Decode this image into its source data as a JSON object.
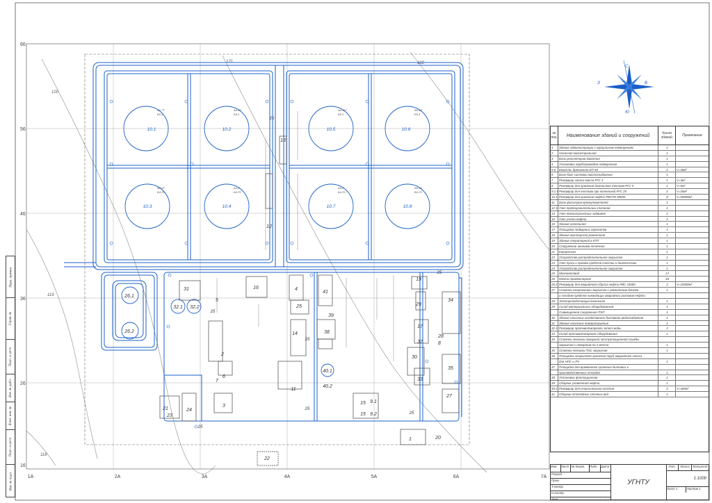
{
  "grid_labels": {
    "rows": [
      "66",
      "56",
      "46",
      "36",
      "26",
      "16"
    ],
    "cols": [
      "1А",
      "2А",
      "3А",
      "4А",
      "5А",
      "6А",
      "7А"
    ]
  },
  "contours": [
    "120",
    "119",
    "118",
    "121",
    "122"
  ],
  "compass": {
    "n": "С",
    "s": "Ю",
    "e": "В",
    "w": "З"
  },
  "tanks": [
    {
      "id": "10.1",
      "tag1": "А2-77",
      "tag2": "Б5-1"
    },
    {
      "id": "10.2",
      "tag1": "А3-97",
      "tag2": "Б5-1"
    },
    {
      "id": "10.5",
      "tag1": "А4-117",
      "tag2": "Б5-1"
    },
    {
      "id": "10.6",
      "tag1": "А5-43",
      "tag2": "Б5-1"
    },
    {
      "id": "10.3",
      "tag1": "А2-97",
      "tag2": "Б4-70"
    },
    {
      "id": "10.4",
      "tag1": "А3-4",
      "tag2": "Б4-70"
    },
    {
      "id": "10.7",
      "tag1": "А4-2",
      "tag2": "Б4-70"
    },
    {
      "id": "10.8",
      "tag1": "А5-54",
      "tag2": "Б4-70"
    }
  ],
  "buildings": [
    "26.1",
    "26.2",
    "31",
    "32.1",
    "32.2",
    "16",
    "25",
    "41",
    "38",
    "40.1",
    "40.2",
    "15",
    "15",
    "9.1",
    "9.2",
    "19",
    "29",
    "17",
    "37",
    "8",
    "28",
    "30",
    "33",
    "27",
    "35",
    "34",
    "5",
    "2",
    "3",
    "4",
    "14",
    "11",
    "21",
    "23",
    "24",
    "6",
    "7",
    "22",
    "1",
    "20",
    "13",
    "12",
    "39"
  ],
  "table": {
    "headers": [
      "№ поз.",
      "Наименование зданий и сооружений",
      "Число зданий",
      "Примечание"
    ],
    "rows": [
      [
        "1",
        "Здание администрации с караульным помещением",
        "1",
        ""
      ],
      [
        "2",
        "Насосная магистральная",
        "1",
        ""
      ],
      [
        "3",
        "Блок регуляторов давления",
        "1",
        ""
      ],
      [
        "4",
        "Установка трубопроводов подварочная",
        "1",
        ""
      ],
      [
        "5-6",
        "Емкость дренажная ЕП-40",
        "2",
        "V=40м³"
      ],
      [
        "6",
        "Блок-бокс системы маслоснабжения",
        "1",
        ""
      ],
      [
        "7",
        "Резервуар запаса масла РГС 3",
        "1",
        "V=3м³"
      ],
      [
        "8",
        "Резервуар для хранения дизельного топлива РГС 5",
        "1",
        "V=5м³"
      ],
      [
        "9.1-9.2",
        "Резервуар для топлива при котельной РГС 25",
        "2",
        "V=25м³"
      ],
      [
        "10.1-10.8",
        "Резервуар для хранения нефти РВСПК 50000",
        "8",
        "V=50000м³"
      ],
      [
        "11",
        "Блок фильтров-грязеуловителей",
        "1",
        ""
      ],
      [
        "12-13",
        "Узел предохранительных клапанов",
        "2",
        ""
      ],
      [
        "14",
        "Узел технологических задвижек",
        "2",
        ""
      ],
      [
        "15",
        "Узел учета нефти",
        "2",
        ""
      ],
      [
        "16",
        "Здание котельной",
        "1",
        ""
      ],
      [
        "17",
        "Площадка подварных агрегатов",
        "1",
        ""
      ],
      [
        "18",
        "Здание мастерской ремонтной",
        "1",
        ""
      ],
      [
        "19",
        "Здание операторной в КТП",
        "1",
        ""
      ],
      [
        "20",
        "Сооружение анонимо-точечное",
        "1",
        ""
      ],
      [
        "21",
        "Караульная",
        "1",
        ""
      ],
      [
        "22",
        "Устройство распределительное закрытое",
        "1",
        ""
      ],
      [
        "23",
        "Узел пуска и приема средств очистки и диагностики",
        "1",
        ""
      ],
      [
        "24",
        "Устройство распределительное закрытое",
        "1",
        ""
      ],
      [
        "25",
        "Молниеотвод",
        "17",
        ""
      ],
      [
        "26",
        "Мачта прожекторная",
        "18",
        ""
      ],
      [
        "26.1-26.2",
        "Резервуар для аварийного сброса нефти РВС 10000",
        "2",
        "V=10000м³"
      ],
      [
        "27",
        "Стоянка спецтехники закрытая с ремонтным блоком",
        "1",
        ""
      ],
      [
        "",
        "и складом средств ликвидации аварийных разливов нефти",
        "",
        ""
      ],
      [
        "28",
        "Электроподстанция дизельная",
        "1",
        ""
      ],
      [
        "29",
        "Склад материальных оборудованный",
        "1",
        ""
      ],
      [
        "",
        "Совмещенное сооружение ПЭП",
        "1",
        ""
      ],
      [
        "30",
        "Здание насосных хозяйственно-бытового водоснабжения",
        "1",
        ""
      ],
      [
        "31",
        "Здание насосных пожаротушения",
        "1",
        ""
      ],
      [
        "32.1-32.2",
        "Резервуар противопожарного запаса воды",
        "2",
        ""
      ],
      [
        "33",
        "Склад противопожарного оборудования",
        "1",
        ""
      ],
      [
        "34",
        "Стоянка техники пожарной эксплуатационной службы",
        "",
        ""
      ],
      [
        "",
        "закрытая с пожарным на 2 места",
        "1",
        ""
      ],
      [
        "35",
        "Стоянка техники ПЭС закрытая",
        "1",
        ""
      ],
      [
        "36",
        "Площадка открытого хранения труб аварийного запаса",
        "",
        ""
      ],
      [
        "",
        "для НПС и ЛЧ",
        "1",
        ""
      ],
      [
        "37",
        "Площадка для временного хранения бытовых и",
        "",
        ""
      ],
      [
        "",
        "производственных отходов",
        "1",
        ""
      ],
      [
        "38",
        "Установка флотационная",
        "1",
        ""
      ],
      [
        "39",
        "Сборник уловленной нефти",
        "1",
        ""
      ],
      [
        "40.1-40.2",
        "Резервуар для статического отстоя",
        "2",
        "V=400м³"
      ],
      [
        "41",
        "Сборник отстойных сточных вод",
        "1",
        ""
      ]
    ]
  },
  "title_block": {
    "org": "УГНТУ",
    "scale": "1:1000",
    "sheet_label": "Лист",
    "sheets_label": "Листов",
    "lit_label": "Лит.",
    "mass_label": "Масса",
    "scale_label": "Масштаб",
    "sheet_num": "1",
    "sheets_num": "1",
    "cols": [
      "Изм.",
      "Лист",
      "№ докум.",
      "Подп.",
      "Дата"
    ],
    "roles": [
      "Разраб.",
      "Пров.",
      "Т.контр.",
      "Н.контр.",
      "Утв."
    ],
    "copied": "Копировал",
    "format": "Формат  А1"
  },
  "side_strip": [
    "Перв. примен.",
    "Справ. №",
    "Подп. и дата",
    "Инв. № дубл.",
    "Взам. инв. №",
    "Подп. и дата",
    "Инв. № подл."
  ]
}
